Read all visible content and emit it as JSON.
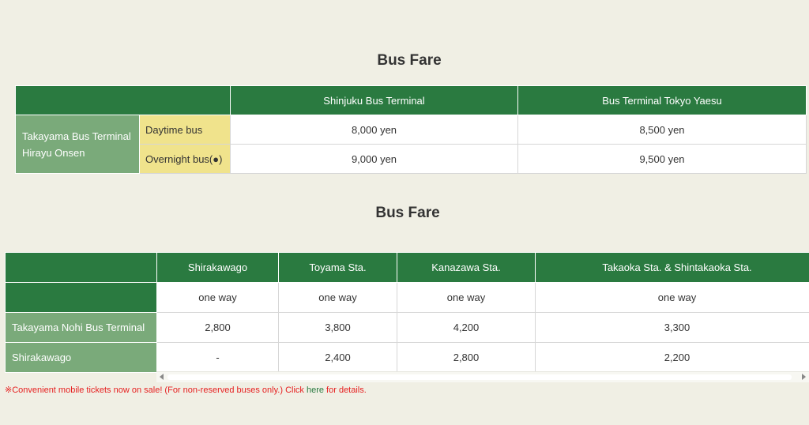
{
  "section1": {
    "title": "Bus Fare",
    "columns": [
      "Shinjuku Bus Terminal",
      "Bus Terminal Tokyo Yaesu"
    ],
    "origin_line1": "Takayama Bus Terminal",
    "origin_line2": "Hirayu Onsen",
    "rows": [
      {
        "type": "Daytime bus",
        "values": [
          "8,000 yen",
          "8,500 yen"
        ]
      },
      {
        "type": "Overnight bus(●)",
        "values": [
          "9,000 yen",
          "9,500 yen"
        ]
      }
    ]
  },
  "section2": {
    "title": "Bus Fare",
    "columns": [
      "Shirakawago",
      "Toyama Sta.",
      "Kanazawa Sta.",
      "Takaoka Sta. & Shintakaoka Sta."
    ],
    "subheader": [
      "one way",
      "one way",
      "one way",
      "one way"
    ],
    "rows": [
      {
        "label": "Takayama Nohi Bus Terminal",
        "values": [
          "2,800",
          "3,800",
          "4,200",
          "3,300"
        ]
      },
      {
        "label": "Shirakawago",
        "values": [
          "-",
          "2,400",
          "2,800",
          "2,200"
        ]
      }
    ]
  },
  "notice": {
    "before": "※Convenient mobile tickets now on sale! (For non-reserved buses only.) Click ",
    "link": "here",
    "after": " for details."
  },
  "colors": {
    "header_green": "#2a7a40",
    "light_green": "#7aaa7a",
    "yellow": "#f0e38c",
    "background": "#f0efe4",
    "notice_red": "#e62020"
  }
}
